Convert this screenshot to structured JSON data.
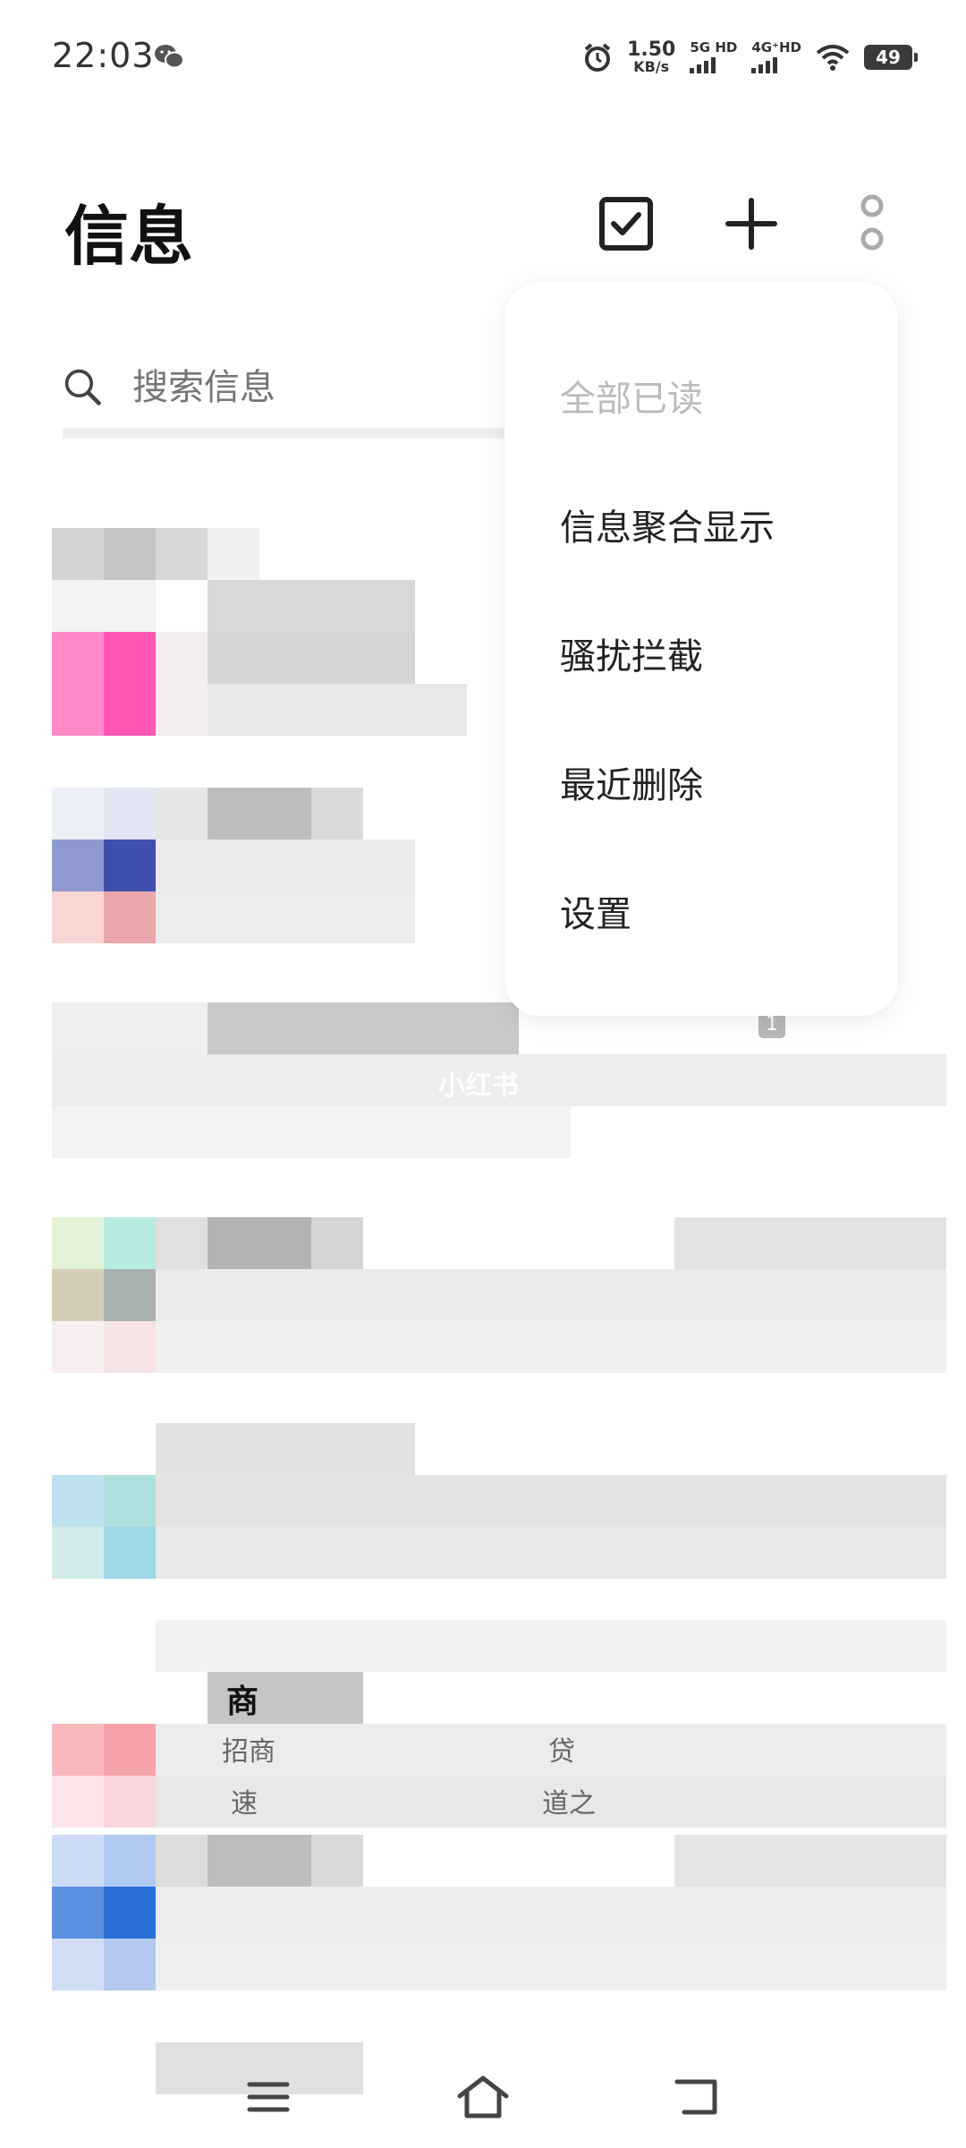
{
  "status_bar": {
    "time": "22:03",
    "speed_value": "1.50",
    "speed_unit": "KB/s",
    "net1": "5G HD",
    "net2": "4G⁺HD",
    "battery": "49"
  },
  "header": {
    "title": "信息"
  },
  "search": {
    "placeholder": "搜索信息"
  },
  "menu": {
    "items": [
      {
        "label": "全部已读",
        "enabled": false
      },
      {
        "label": "信息聚合显示",
        "enabled": true
      },
      {
        "label": "骚扰拦截",
        "enabled": true
      },
      {
        "label": "最近删除",
        "enabled": true
      },
      {
        "label": "设置",
        "enabled": true
      }
    ]
  },
  "list": {
    "watermark": "小红书",
    "badge": "1",
    "snippet": [
      "商",
      "招商",
      "速",
      "贷",
      "道之"
    ]
  },
  "colors": {
    "accent": "#222222",
    "disabled": "#bbbbbb",
    "avatar_pink": "#ff55b4",
    "avatar_indigo": "#3e4fae",
    "avatar_teal": "#9fd8e6",
    "avatar_blue": "#2a6fd8",
    "avatar_red": "#f5a2ab"
  }
}
